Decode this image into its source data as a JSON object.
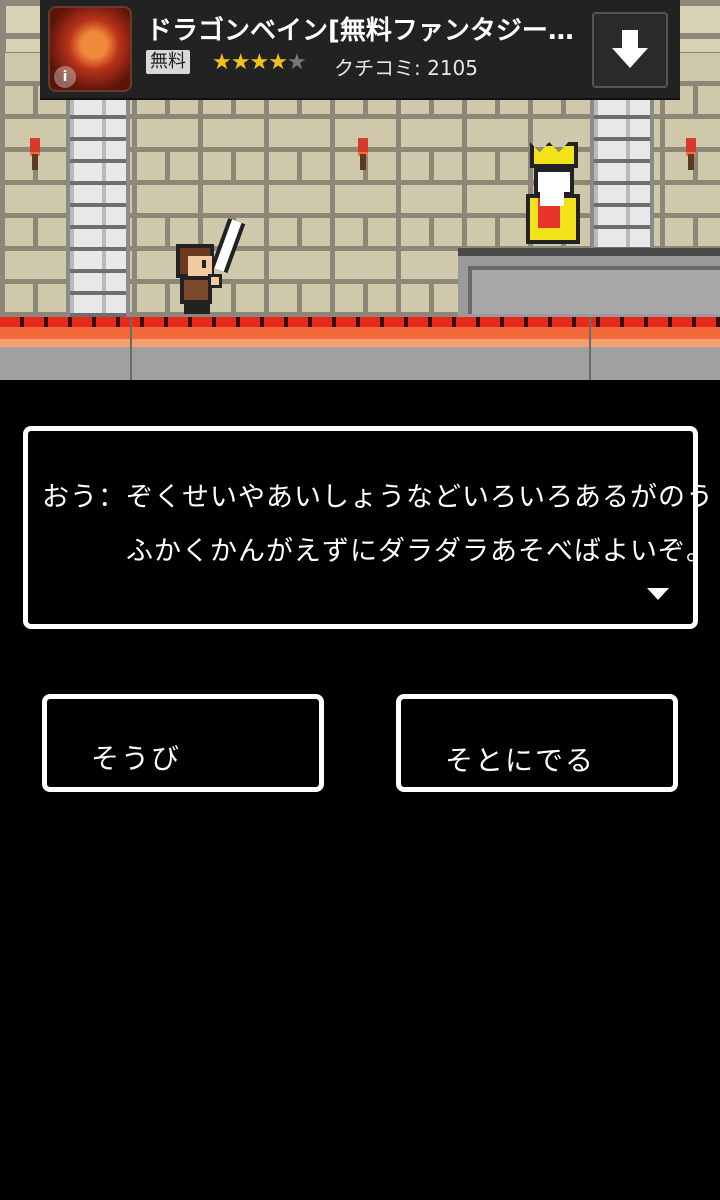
{
  "ad": {
    "title": "ドラゴンベイン[無料ファンタジー…",
    "price_badge": "無料",
    "rating": 4,
    "rating_max": 5,
    "reviews": "クチコミ: 2105",
    "icons": [
      "app-icon",
      "info-icon",
      "download-icon"
    ]
  },
  "dialog": {
    "line1": "おう：ぞくせいやあいしょうなどいろいろあるがのう",
    "line2": "ふかくかんがえずにダラダラあそべばよいぞ。"
  },
  "buttons": {
    "equip": "そうび",
    "go_out": "そとにでる"
  },
  "colors": {
    "background": "#000000",
    "text": "#ffffff",
    "lava": "#e82a1c",
    "crown": "#f2e21a"
  }
}
